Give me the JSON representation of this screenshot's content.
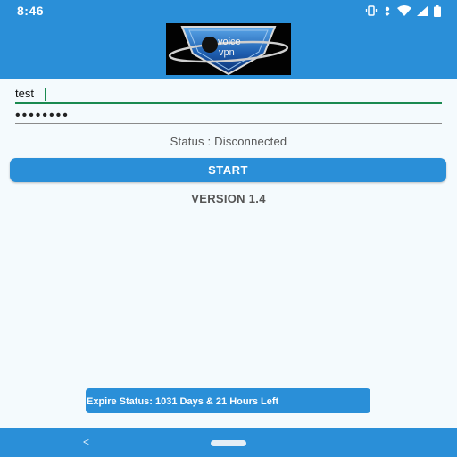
{
  "status_bar": {
    "time": "8:46",
    "icons": [
      "vibrate-icon",
      "data-saver-icon",
      "wifi-icon",
      "signal-icon",
      "battery-icon"
    ]
  },
  "header": {
    "logo_text_top": "voice",
    "logo_text_bottom": "vpn"
  },
  "form": {
    "username_value": "test",
    "password_mask": "••••••••"
  },
  "status": {
    "text": "Status : Disconnected"
  },
  "start_button": {
    "label": "START"
  },
  "version": {
    "text": "VERSION 1.4"
  },
  "expire": {
    "text": "Expire Status: 1031 Days & 21 Hours Left"
  },
  "nav": {
    "back_glyph": "<"
  },
  "colors": {
    "primary": "#2a8fd8",
    "background": "#f4fafd",
    "input_focus": "#1a8a50"
  }
}
